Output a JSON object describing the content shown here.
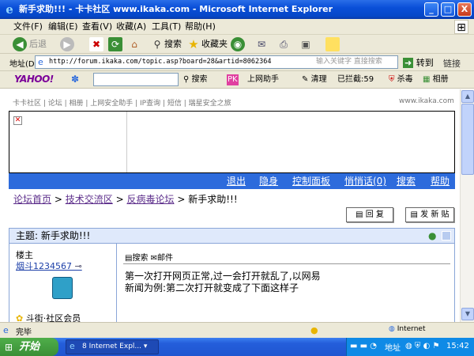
{
  "window": {
    "title": "新手求助!!! - 卡卡社区 www.ikaka.com - Microsoft Internet Explorer",
    "min": "_",
    "max": "□",
    "close": "X"
  },
  "menu": [
    "文件(F)",
    "编辑(E)",
    "查看(V)",
    "收藏(A)",
    "工具(T)",
    "帮助(H)"
  ],
  "toolbar": {
    "back": "后退",
    "search": "搜索",
    "favorites": "收藏夹"
  },
  "address": {
    "label": "地址(D)",
    "url": "http://forum.ikaka.com/topic.asp?board=28&artid=8062364",
    "hint": "输入关键字 直接搜索",
    "go": "转到",
    "links": "链接"
  },
  "yahoo_bar": {
    "logo": "YAHOO!",
    "search": "搜索",
    "assistant": "上网助手",
    "clean": "清理",
    "blocked": "已拦截:59",
    "antivirus": "杀毒",
    "album": "相册"
  },
  "page": {
    "top_nav": "卡卡社区 | 论坛 | 相册 | 上网安全助手 | IP查询 | 短信 | 瑞星安全之旅",
    "site": "www.ikaka.com",
    "nav_links": [
      "退出",
      "隐身",
      "控制面板",
      "悄悄话(0)",
      "搜索",
      "帮助"
    ],
    "breadcrumb": [
      "论坛首页",
      "技术交流区",
      "反病毒论坛"
    ],
    "breadcrumb_sep": ">",
    "breadcrumb_current": "新手求助!!!",
    "reply_button": "回 复",
    "new_post_button": "发 新 贴",
    "topic_label": "主题: 新手求助!!!",
    "post": {
      "floor": "楼主",
      "username": "烟斗1234567",
      "rank": "斗街·社区会员",
      "tool_search": "搜索",
      "tool_mail": "邮件",
      "body_line1": "第一次打开网页正常,过一会打开就乱了,以网易",
      "body_line2": "新闻为例:第二次打开就变成了下面这样子"
    }
  },
  "statusbar": {
    "text": "完毕",
    "zone": "Internet"
  },
  "taskbar": {
    "start": "开始",
    "task": "8 Internet Expl...",
    "tray_address": "地址",
    "clock": "15:42"
  },
  "colors": {
    "title_blue": "#0a4fd8",
    "nav_blue": "#2d6bdc",
    "link_purple": "#5b2c8a"
  }
}
